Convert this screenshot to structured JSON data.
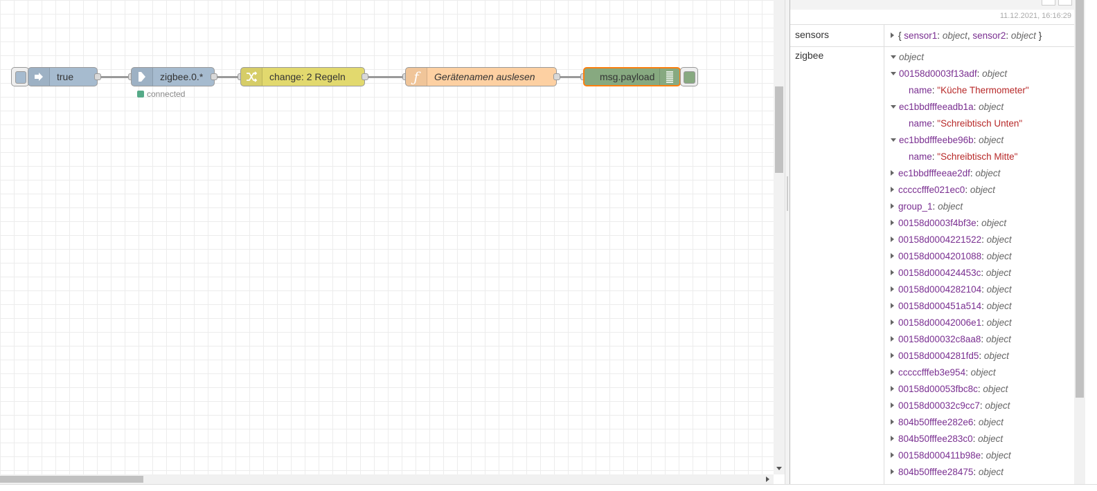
{
  "flow": {
    "nodes": [
      {
        "id": "inject",
        "label": "true",
        "color": "#a6bbcf",
        "icon": "arrow-right-icon"
      },
      {
        "id": "zigbee",
        "label": "zigbee.0.*",
        "color": "#a6bbcf",
        "icon": "iobroker-in-icon",
        "status": "connected"
      },
      {
        "id": "change",
        "label": "change: 2 Regeln",
        "color": "#e2d96e",
        "icon": "shuffle-icon"
      },
      {
        "id": "function",
        "label": "Gerätenamen auslesen",
        "color": "#fdd0a2",
        "icon": "function-icon"
      },
      {
        "id": "debug",
        "label": "msg.payload",
        "color": "#87a980",
        "icon": "list-icon"
      }
    ]
  },
  "debug": {
    "timestamp": "11.12.2021, 16:16:29",
    "sensors": {
      "key": "sensors",
      "open": "{ ",
      "k1": "sensor1",
      "sep": ": ",
      "t1": "object",
      "comma": ", ",
      "k2": "sensor2",
      "t2": "object",
      "close": " }"
    },
    "zigbee": {
      "key": "zigbee",
      "type": "object",
      "entries": [
        {
          "key": "00158d0003f13adf",
          "type": "object",
          "expanded": true,
          "child_key": "name",
          "child_value": "\"Küche Thermometer\""
        },
        {
          "key": "ec1bbdfffeeadb1a",
          "type": "object",
          "expanded": true,
          "child_key": "name",
          "child_value": "\"Schreibtisch Unten\""
        },
        {
          "key": "ec1bbdfffeebe96b",
          "type": "object",
          "expanded": true,
          "child_key": "name",
          "child_value": "\"Schreibtisch Mitte\""
        },
        {
          "key": "ec1bbdfffeeae2df",
          "type": "object"
        },
        {
          "key": "cccccfffe021ec0",
          "type": "object"
        },
        {
          "key": "group_1",
          "type": "object"
        },
        {
          "key": "00158d0003f4bf3e",
          "type": "object"
        },
        {
          "key": "00158d0004221522",
          "type": "object"
        },
        {
          "key": "00158d0004201088",
          "type": "object"
        },
        {
          "key": "00158d000424453c",
          "type": "object"
        },
        {
          "key": "00158d0004282104",
          "type": "object"
        },
        {
          "key": "00158d000451a514",
          "type": "object"
        },
        {
          "key": "00158d00042006e1",
          "type": "object"
        },
        {
          "key": "00158d00032c8aa8",
          "type": "object"
        },
        {
          "key": "00158d0004281fd5",
          "type": "object"
        },
        {
          "key": "cccccfffeb3e954",
          "type": "object"
        },
        {
          "key": "00158d00053fbc8c",
          "type": "object"
        },
        {
          "key": "00158d00032c9cc7",
          "type": "object"
        },
        {
          "key": "804b50fffee282e6",
          "type": "object"
        },
        {
          "key": "804b50fffee283c0",
          "type": "object"
        },
        {
          "key": "00158d000411b98e",
          "type": "object"
        },
        {
          "key": "804b50fffee28475",
          "type": "object"
        }
      ]
    }
  }
}
